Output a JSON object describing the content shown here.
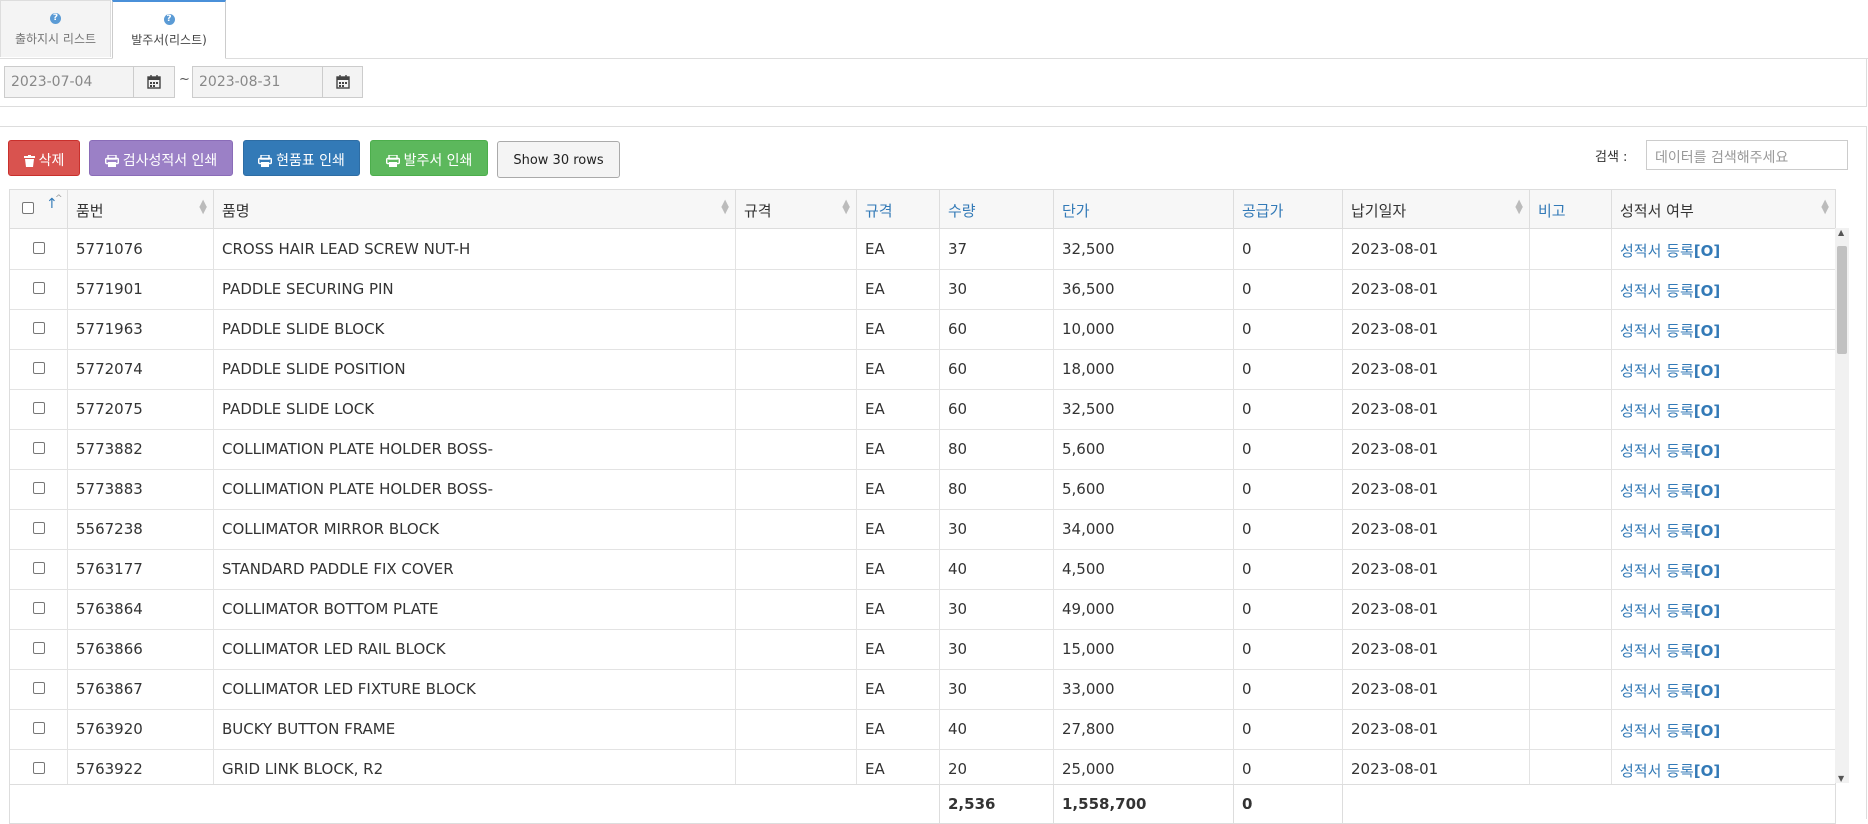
{
  "tabs": [
    {
      "label": "출하지시 리스트",
      "active": false,
      "icon": "question-icon"
    },
    {
      "label": "발주서(리스트)",
      "active": true,
      "icon": "question-icon"
    }
  ],
  "date_range": {
    "from": "2023-07-04",
    "to": "2023-08-31",
    "separator": "~",
    "icon": "calendar-icon"
  },
  "toolbar": {
    "delete_label": "삭제",
    "print_inspection_label": "검사성적서 인쇄",
    "print_current_label": "현품표 인쇄",
    "print_order_label": "발주서 인쇄",
    "show_rows_label": "Show 30 rows",
    "search_label": "검색 :",
    "search_placeholder": "데이터를 검색해주세요"
  },
  "colors": {
    "delete": "#d9534f",
    "inspection": "#9b80c6",
    "current": "#337ab7",
    "order": "#5cb85c",
    "link": "#337ab7"
  },
  "table": {
    "columns": [
      "품번",
      "품명",
      "규격",
      "규격",
      "수량",
      "단가",
      "공급가",
      "납기일자",
      "비고",
      "성적서 여부"
    ],
    "rows": [
      {
        "part_no": "5771076",
        "name": "CROSS HAIR LEAD SCREW NUT-H",
        "spec": "",
        "unit": "EA",
        "qty": "37",
        "price": "32,500",
        "supply": "0",
        "due": "2023-08-01",
        "note": "",
        "cert_text": "성적서 등록",
        "cert_mark": "[O]"
      },
      {
        "part_no": "5771901",
        "name": "PADDLE SECURING PIN",
        "spec": "",
        "unit": "EA",
        "qty": "30",
        "price": "36,500",
        "supply": "0",
        "due": "2023-08-01",
        "note": "",
        "cert_text": "성적서 등록",
        "cert_mark": "[O]"
      },
      {
        "part_no": "5771963",
        "name": "PADDLE SLIDE BLOCK",
        "spec": "",
        "unit": "EA",
        "qty": "60",
        "price": "10,000",
        "supply": "0",
        "due": "2023-08-01",
        "note": "",
        "cert_text": "성적서 등록",
        "cert_mark": "[O]"
      },
      {
        "part_no": "5772074",
        "name": "PADDLE SLIDE POSITION",
        "spec": "",
        "unit": "EA",
        "qty": "60",
        "price": "18,000",
        "supply": "0",
        "due": "2023-08-01",
        "note": "",
        "cert_text": "성적서 등록",
        "cert_mark": "[O]"
      },
      {
        "part_no": "5772075",
        "name": "PADDLE SLIDE LOCK",
        "spec": "",
        "unit": "EA",
        "qty": "60",
        "price": "32,500",
        "supply": "0",
        "due": "2023-08-01",
        "note": "",
        "cert_text": "성적서 등록",
        "cert_mark": "[O]"
      },
      {
        "part_no": "5773882",
        "name": "COLLIMATION PLATE HOLDER BOSS-",
        "spec": "",
        "unit": "EA",
        "qty": "80",
        "price": "5,600",
        "supply": "0",
        "due": "2023-08-01",
        "note": "",
        "cert_text": "성적서 등록",
        "cert_mark": "[O]"
      },
      {
        "part_no": "5773883",
        "name": "COLLIMATION PLATE HOLDER BOSS-",
        "spec": "",
        "unit": "EA",
        "qty": "80",
        "price": "5,600",
        "supply": "0",
        "due": "2023-08-01",
        "note": "",
        "cert_text": "성적서 등록",
        "cert_mark": "[O]"
      },
      {
        "part_no": "5567238",
        "name": "COLLIMATOR MIRROR BLOCK",
        "spec": "",
        "unit": "EA",
        "qty": "30",
        "price": "34,000",
        "supply": "0",
        "due": "2023-08-01",
        "note": "",
        "cert_text": "성적서 등록",
        "cert_mark": "[O]"
      },
      {
        "part_no": "5763177",
        "name": "STANDARD PADDLE FIX COVER",
        "spec": "",
        "unit": "EA",
        "qty": "40",
        "price": "4,500",
        "supply": "0",
        "due": "2023-08-01",
        "note": "",
        "cert_text": "성적서 등록",
        "cert_mark": "[O]"
      },
      {
        "part_no": "5763864",
        "name": "COLLIMATOR BOTTOM PLATE",
        "spec": "",
        "unit": "EA",
        "qty": "30",
        "price": "49,000",
        "supply": "0",
        "due": "2023-08-01",
        "note": "",
        "cert_text": "성적서 등록",
        "cert_mark": "[O]"
      },
      {
        "part_no": "5763866",
        "name": "COLLIMATOR LED RAIL BLOCK",
        "spec": "",
        "unit": "EA",
        "qty": "30",
        "price": "15,000",
        "supply": "0",
        "due": "2023-08-01",
        "note": "",
        "cert_text": "성적서 등록",
        "cert_mark": "[O]"
      },
      {
        "part_no": "5763867",
        "name": "COLLIMATOR LED FIXTURE BLOCK",
        "spec": "",
        "unit": "EA",
        "qty": "30",
        "price": "33,000",
        "supply": "0",
        "due": "2023-08-01",
        "note": "",
        "cert_text": "성적서 등록",
        "cert_mark": "[O]"
      },
      {
        "part_no": "5763920",
        "name": "BUCKY BUTTON FRAME",
        "spec": "",
        "unit": "EA",
        "qty": "40",
        "price": "27,800",
        "supply": "0",
        "due": "2023-08-01",
        "note": "",
        "cert_text": "성적서 등록",
        "cert_mark": "[O]"
      },
      {
        "part_no": "5763922",
        "name": "GRID LINK BLOCK, R2",
        "spec": "",
        "unit": "EA",
        "qty": "20",
        "price": "25,000",
        "supply": "0",
        "due": "2023-08-01",
        "note": "",
        "cert_text": "성적서 등록",
        "cert_mark": "[O]"
      }
    ],
    "totals": {
      "qty": "2,536",
      "price": "1,558,700",
      "supply": "0"
    }
  }
}
